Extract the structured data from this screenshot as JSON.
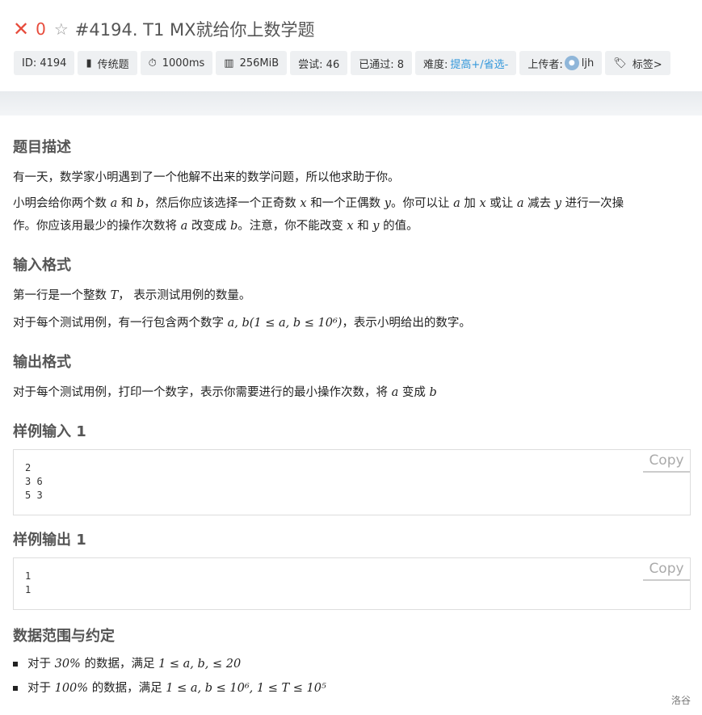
{
  "header": {
    "score": "0",
    "title": "#4194. T1 MX就给你上数学题",
    "chips": {
      "id": "ID: 4194",
      "type": "传统题",
      "time": "1000ms",
      "memory": "256MiB",
      "tries": "尝试: 46",
      "passed": "已通过: 8",
      "difficulty_label": "难度:",
      "difficulty_value": "提高+/省选-",
      "uploader_label": "上传者:",
      "uploader_name": "ljh",
      "tags": "标签>"
    }
  },
  "sections": {
    "desc_title": "题目描述",
    "desc_p1": "有一天，数学家小明遇到了一个他解不出来的数学问题，所以他求助于你。",
    "desc_p2_a": "小明会给你两个数",
    "desc_p2_b": "和",
    "desc_p2_c": "，然后你应该选择一个正奇数",
    "desc_p2_d": "和一个正偶数",
    "desc_p2_e": "。你可以让",
    "desc_p2_f": "加",
    "desc_p2_g": "或让",
    "desc_p2_h": "减去",
    "desc_p2_i": "进行一次操",
    "desc_p3_a": "作。你应该用最少的操作次数将",
    "desc_p3_b": "改变成",
    "desc_p3_c": "。注意，你不能改变",
    "desc_p3_d": "和",
    "desc_p3_e": "的值。",
    "input_title": "输入格式",
    "input_p1_a": "第一行是一个整数",
    "input_p1_b": "， 表示测试用例的数量。",
    "input_p2_a": "对于每个测试用例，有一行包含两个数字",
    "input_p2_b": "，表示小明给出的数字。",
    "output_title": "输出格式",
    "output_p1_a": "对于每个测试用例，打印一个数字，表示你需要进行的最小操作次数，将",
    "output_p1_b": "变成",
    "sample_in_title": "样例输入 1",
    "sample_in": "2\n3 6\n5 3",
    "sample_out_title": "样例输出 1",
    "sample_out": "1\n1",
    "copy_label": "Copy",
    "range_title": "数据范围与约定",
    "range_1_a": "对于",
    "range_1_b": "30%",
    "range_1_c": "的数据，满足",
    "range_1_d": "1 ≤ a, b, ≤ 20",
    "range_2_a": "对于",
    "range_2_b": "100%",
    "range_2_c": "的数据，满足",
    "range_2_d": "1 ≤ a, b ≤ 10⁶, 1 ≤ T ≤ 10⁵"
  },
  "vars": {
    "a": "a",
    "b": "b",
    "x": "x",
    "y": "y",
    "T": "T",
    "ab_range": "a, b(1 ≤ a, b ≤ 10⁶)"
  },
  "footer": {
    "logo": "洛谷"
  },
  "colors": {
    "accent_red": "#e74c3c",
    "link_blue": "#3498db",
    "chip_bg": "#eef0f2"
  }
}
